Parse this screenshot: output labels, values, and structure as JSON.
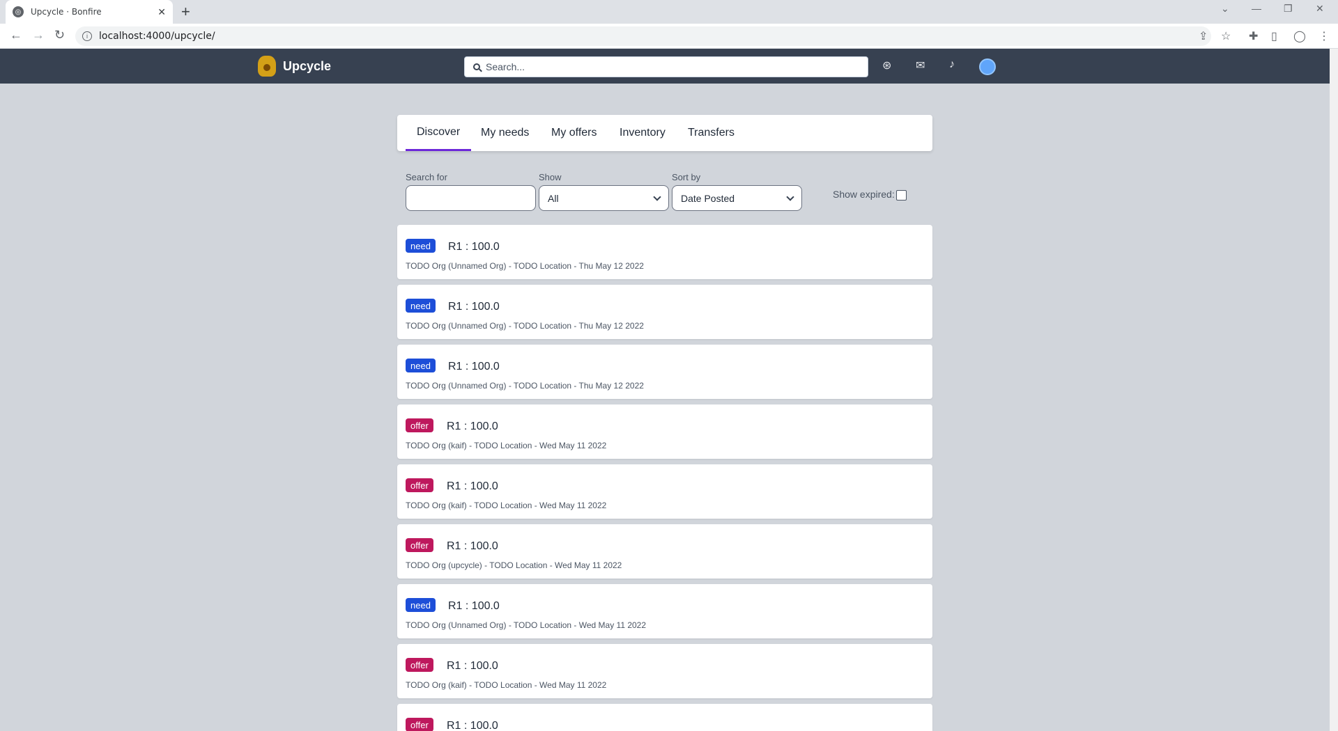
{
  "browser": {
    "tab_title": "Upcycle · Bonfire",
    "url": "localhost:4000/upcycle/"
  },
  "header": {
    "brand": "Upcycle",
    "search_placeholder": "Search..."
  },
  "tabs": [
    {
      "label": "Discover",
      "active": true
    },
    {
      "label": "My needs",
      "active": false
    },
    {
      "label": "My offers",
      "active": false
    },
    {
      "label": "Inventory",
      "active": false
    },
    {
      "label": "Transfers",
      "active": false
    }
  ],
  "filters": {
    "search_label": "Search for",
    "search_value": "",
    "show_label": "Show",
    "show_value": "All",
    "sort_label": "Sort by",
    "sort_value": "Date Posted",
    "expired_label": "Show expired:",
    "expired_checked": false
  },
  "items": [
    {
      "type": "need",
      "resource": "R1 : 100.0",
      "meta": "TODO Org (Unnamed Org) - TODO Location - Thu May 12 2022"
    },
    {
      "type": "need",
      "resource": "R1 : 100.0",
      "meta": "TODO Org (Unnamed Org) - TODO Location - Thu May 12 2022"
    },
    {
      "type": "need",
      "resource": "R1 : 100.0",
      "meta": "TODO Org (Unnamed Org) - TODO Location - Thu May 12 2022"
    },
    {
      "type": "offer",
      "resource": "R1 : 100.0",
      "meta": "TODO Org (kaif) - TODO Location - Wed May 11 2022"
    },
    {
      "type": "offer",
      "resource": "R1 : 100.0",
      "meta": "TODO Org (kaif) - TODO Location - Wed May 11 2022"
    },
    {
      "type": "offer",
      "resource": "R1 : 100.0",
      "meta": "TODO Org (upcycle) - TODO Location - Wed May 11 2022"
    },
    {
      "type": "need",
      "resource": "R1 : 100.0",
      "meta": "TODO Org (Unnamed Org) - TODO Location - Wed May 11 2022"
    },
    {
      "type": "offer",
      "resource": "R1 : 100.0",
      "meta": "TODO Org (kaif) - TODO Location - Wed May 11 2022"
    },
    {
      "type": "offer",
      "resource": "R1 : 100.0",
      "meta": ""
    }
  ],
  "colors": {
    "header_bg": "#374151",
    "need_badge": "#1d4ed8",
    "offer_badge": "#be185d",
    "active_tab": "#6d28d9"
  }
}
